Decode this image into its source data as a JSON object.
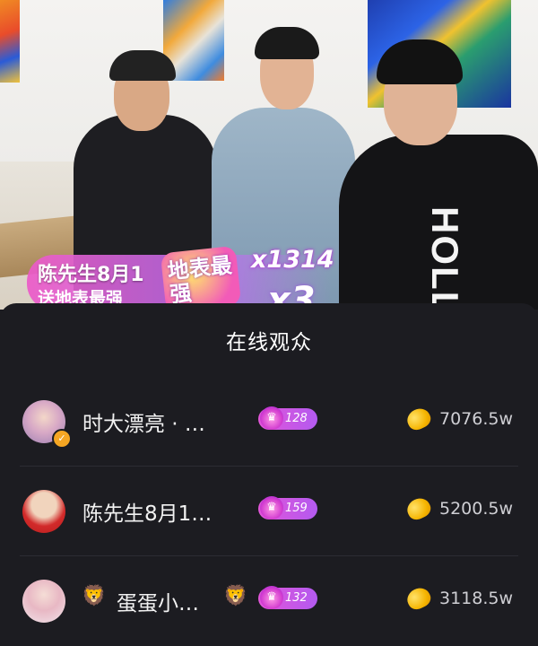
{
  "live_overlay": {
    "gift_sender": "陈先生8月1",
    "gift_subtitle": "送地表最强",
    "gift_icon_text": "地表最强",
    "gift_count": "x1314",
    "combo": "x3",
    "hoodie_text": "HOLL"
  },
  "audience_panel": {
    "title": "在线观众",
    "users": [
      {
        "name": "时大漂亮 · …",
        "level": "128",
        "beans": "7076.5w",
        "avatar_icon": "user-avatar-icon",
        "verified": true,
        "lion_prefix": "",
        "lion_suffix": ""
      },
      {
        "name": "陈先生8月1…",
        "level": "159",
        "beans": "5200.5w",
        "avatar_icon": "user-avatar-icon",
        "verified": false,
        "lion_prefix": "",
        "lion_suffix": ""
      },
      {
        "name": "蛋蛋小…",
        "level": "132",
        "beans": "3118.5w",
        "avatar_icon": "user-avatar-icon",
        "verified": false,
        "lion_prefix": "🦁",
        "lion_suffix": "🦁"
      }
    ]
  },
  "colors": {
    "panel_bg": "#1c1c21",
    "badge_start": "#e255d8",
    "badge_end": "#b35af0",
    "bean": "#f5b400"
  }
}
